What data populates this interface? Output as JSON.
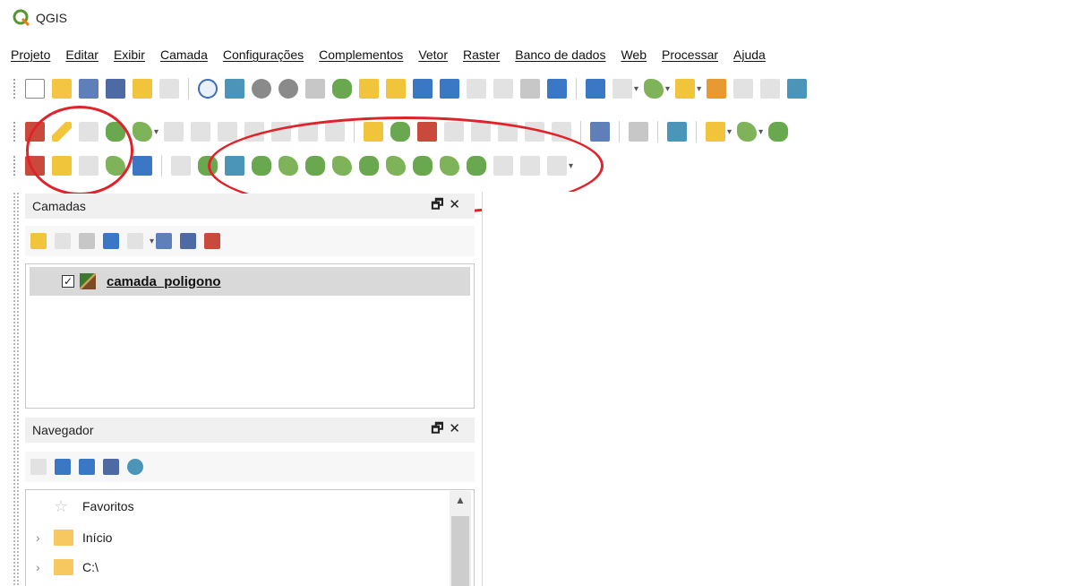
{
  "app": {
    "title": "QGIS"
  },
  "menu": [
    "Projeto",
    "Editar",
    "Exibir",
    "Camada",
    "Configurações",
    "Complementos",
    "Vetor",
    "Raster",
    "Banco de dados",
    "Web",
    "Processar",
    "Ajuda"
  ],
  "layers_panel": {
    "title": "Camadas",
    "layers": [
      {
        "name": "camada_poligono",
        "checked": true
      }
    ]
  },
  "browser_panel": {
    "title": "Navegador",
    "items": [
      {
        "label": "Favoritos",
        "icon": "star-icon"
      },
      {
        "label": "Início",
        "icon": "folder-icon"
      },
      {
        "label": "C:\\",
        "icon": "folder-icon"
      }
    ]
  },
  "panel_controls": {
    "float": "🗗",
    "close": "✕"
  },
  "colors": {
    "annotation": "#e0222a",
    "selected_row": "#d9d9d9"
  }
}
